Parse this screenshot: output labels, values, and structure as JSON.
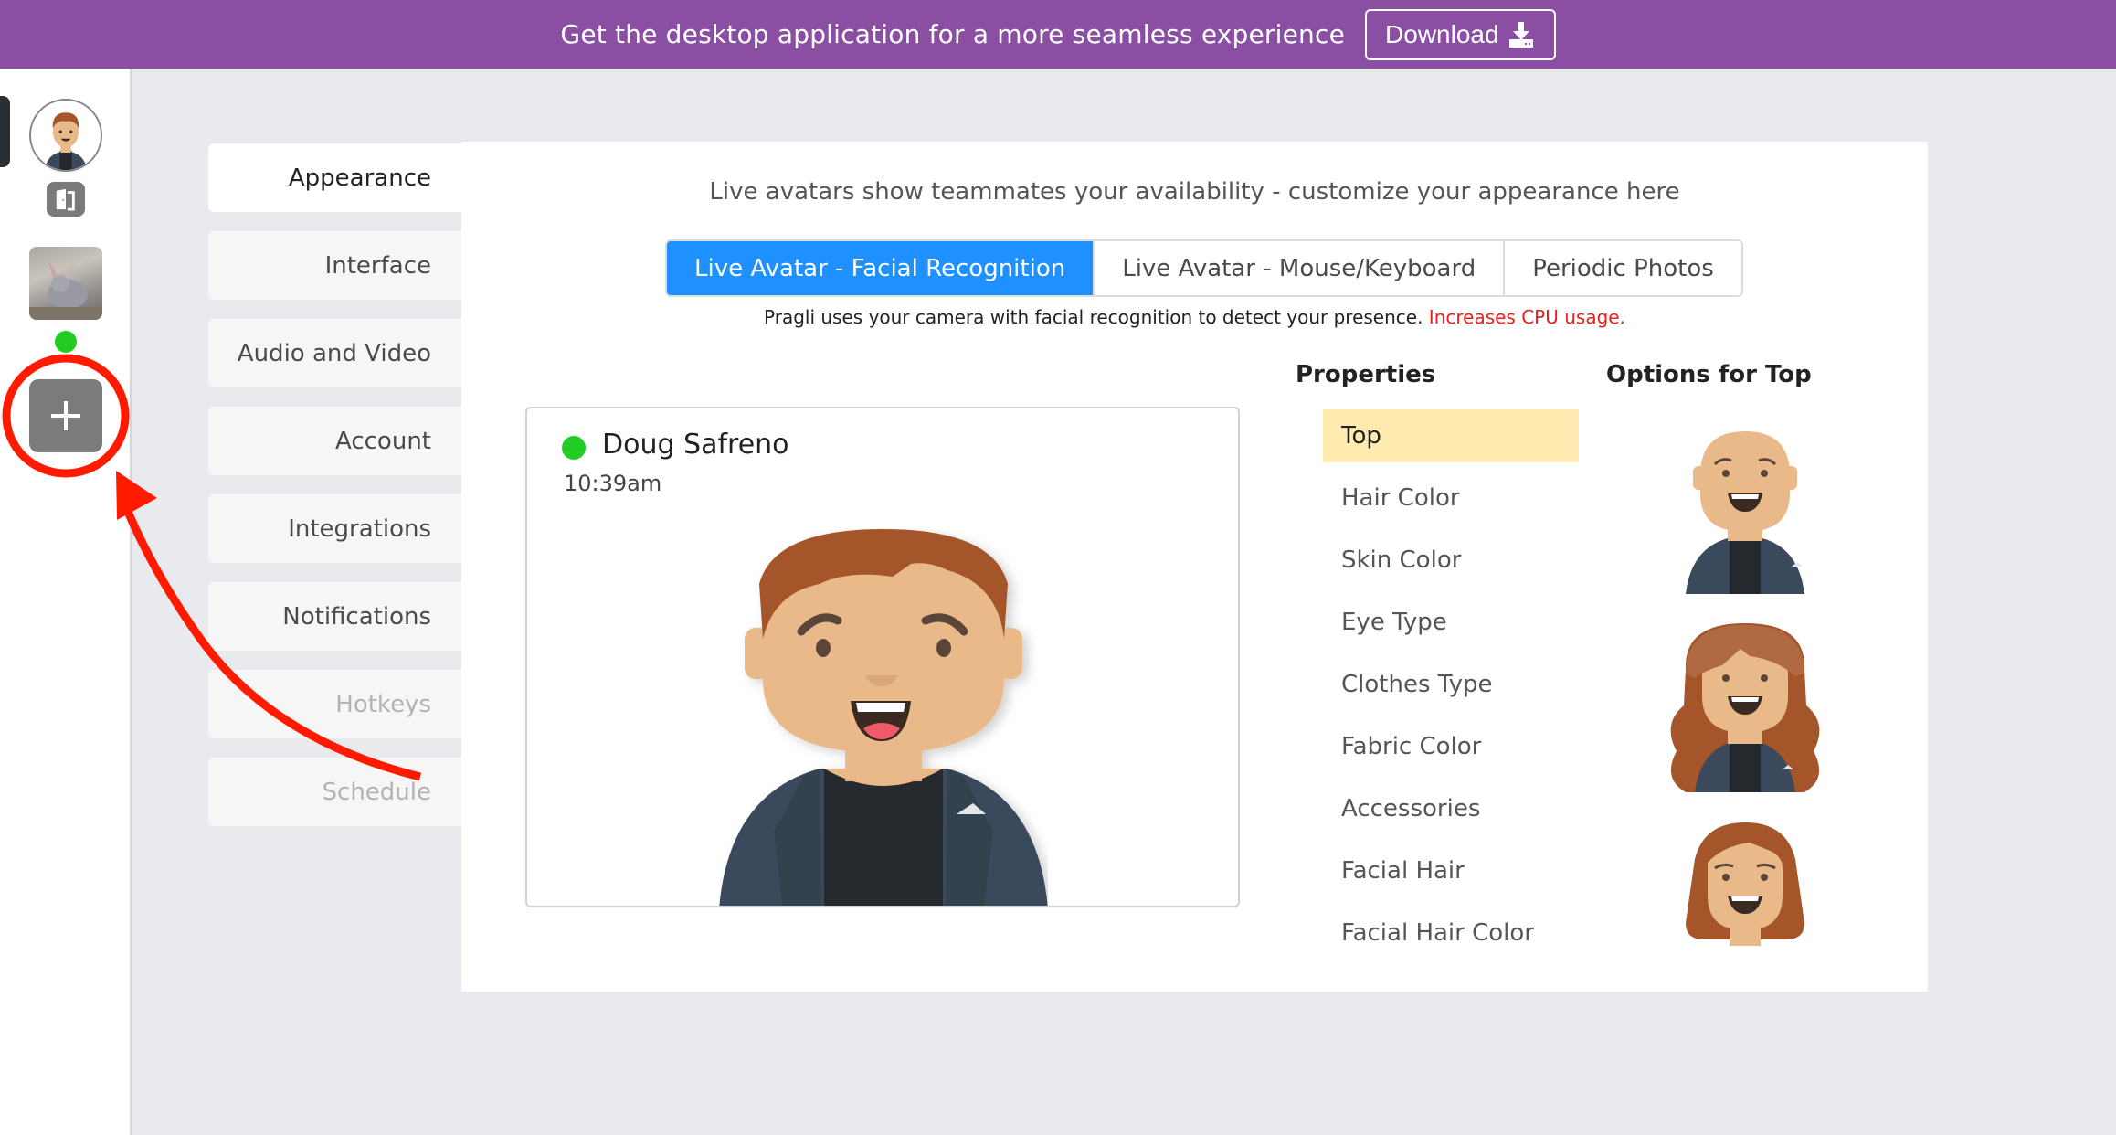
{
  "banner": {
    "message": "Get the desktop application for a more seamless experience",
    "download_label": "Download",
    "download_icon": "download-icon",
    "background_color": "#8a4fa3"
  },
  "rail": {
    "items": [
      {
        "name": "user-avatar",
        "icon": "avatar-icon"
      },
      {
        "name": "door",
        "icon": "door-icon"
      },
      {
        "name": "team-photo",
        "icon": "photo-icon"
      },
      {
        "name": "online-status",
        "icon": "status-dot-icon",
        "color": "#22cc22"
      },
      {
        "name": "add-team",
        "icon": "plus-icon"
      }
    ]
  },
  "nav": {
    "items": [
      {
        "label": "Appearance",
        "state": "active"
      },
      {
        "label": "Interface",
        "state": "normal"
      },
      {
        "label": "Audio and Video",
        "state": "normal"
      },
      {
        "label": "Account",
        "state": "normal"
      },
      {
        "label": "Integrations",
        "state": "normal"
      },
      {
        "label": "Notifications",
        "state": "normal"
      },
      {
        "label": "Hotkeys",
        "state": "disabled"
      },
      {
        "label": "Schedule",
        "state": "disabled"
      }
    ]
  },
  "main": {
    "intro": "Live avatars show teammates your availability - customize your appearance here",
    "tabs": [
      {
        "label": "Live Avatar - Facial Recognition",
        "active": true
      },
      {
        "label": "Live Avatar - Mouse/Keyboard",
        "active": false
      },
      {
        "label": "Periodic Photos",
        "active": false
      }
    ],
    "tab_description": "Pragli uses your camera with facial recognition to detect your presence.",
    "tab_warning": "Increases CPU usage.",
    "accent_color": "#1e90ff",
    "warning_color": "#e8201e"
  },
  "card": {
    "name": "Doug Safreno",
    "time": "10:39am",
    "status_color": "#22cc22"
  },
  "properties": {
    "title": "Properties",
    "items": [
      "Top",
      "Hair Color",
      "Skin Color",
      "Eye Type",
      "Clothes Type",
      "Fabric Color",
      "Accessories",
      "Facial Hair",
      "Facial Hair Color"
    ],
    "selected": "Top"
  },
  "options": {
    "title": "Options for Top",
    "items": [
      "bald",
      "long-wavy-hair",
      "bob-hair"
    ]
  }
}
